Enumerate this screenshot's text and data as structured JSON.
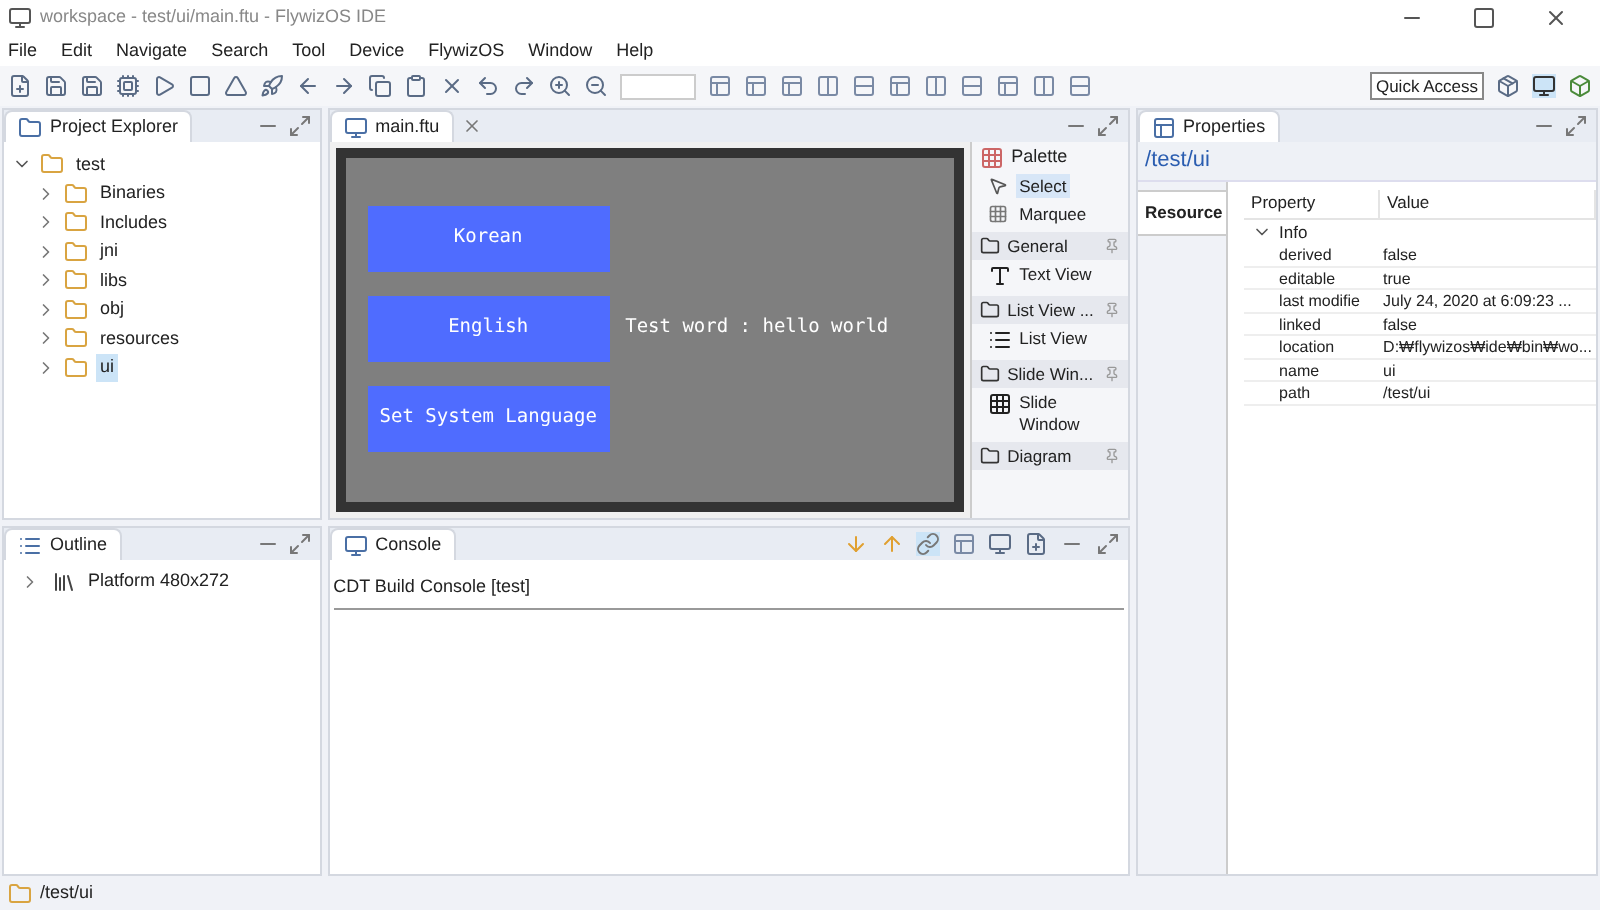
{
  "window": {
    "title": "workspace - test/ui/main.ftu - FlywizOS IDE"
  },
  "menu": [
    "File",
    "Edit",
    "Navigate",
    "Search",
    "Tool",
    "Device",
    "FlywizOS",
    "Window",
    "Help"
  ],
  "quick_access": "Quick Access",
  "project_explorer": {
    "title": "Project Explorer",
    "tree": [
      {
        "label": "test",
        "expanded": true,
        "selected": false,
        "children": [
          {
            "label": "Binaries",
            "expanded": false,
            "selected": false
          },
          {
            "label": "Includes",
            "expanded": false,
            "selected": false
          },
          {
            "label": "jni",
            "expanded": false,
            "selected": false
          },
          {
            "label": "libs",
            "expanded": false,
            "selected": false
          },
          {
            "label": "obj",
            "expanded": false,
            "selected": false
          },
          {
            "label": "resources",
            "expanded": false,
            "selected": false
          },
          {
            "label": "ui",
            "expanded": false,
            "selected": true
          }
        ]
      }
    ]
  },
  "editor": {
    "tab": "main.ftu",
    "buttons": [
      "Korean",
      "English",
      "Set System Language"
    ],
    "label": "Test word : hello world"
  },
  "palette": {
    "title": "Palette",
    "tools": [
      {
        "label": "Select",
        "selected": true
      },
      {
        "label": "Marquee",
        "selected": false
      }
    ],
    "groups": [
      {
        "title": "General",
        "items": [
          "Text View"
        ]
      },
      {
        "title": "List View ...",
        "items": [
          "List View"
        ]
      },
      {
        "title": "Slide Win...",
        "items": [
          "Slide Window"
        ]
      },
      {
        "title": "Diagram"
      }
    ]
  },
  "outline": {
    "title": "Outline",
    "items": [
      "Platform 480x272"
    ]
  },
  "console": {
    "title": "Console",
    "header": "CDT Build Console [test]"
  },
  "properties": {
    "title": "Properties",
    "path": "/test/ui",
    "tab": "Resource",
    "columns": [
      "Property",
      "Value"
    ],
    "group": "Info",
    "rows": [
      {
        "name": "derived",
        "value": "false"
      },
      {
        "name": "editable",
        "value": "true"
      },
      {
        "name": "last modifie",
        "value": "July 24, 2020 at 6:09:23 ..."
      },
      {
        "name": "linked",
        "value": "false"
      },
      {
        "name": "location",
        "value": "D:₩flywizos₩ide₩bin₩wo..."
      },
      {
        "name": "name",
        "value": "ui"
      },
      {
        "name": "path",
        "value": "/test/ui"
      }
    ]
  },
  "status_bar": {
    "text": "/test/ui"
  }
}
